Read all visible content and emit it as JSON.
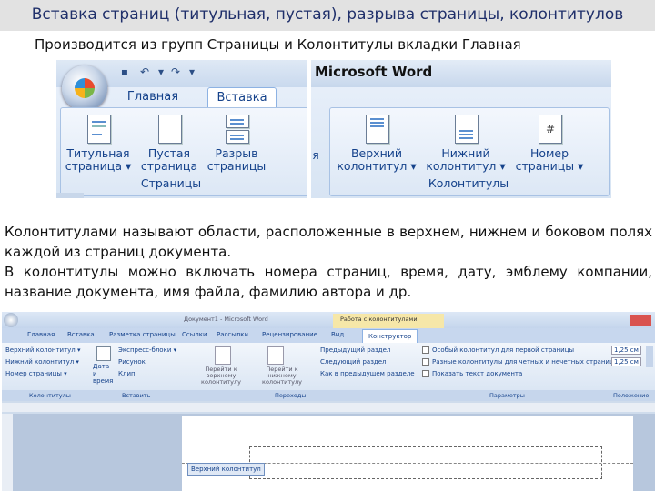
{
  "slide": {
    "title": "Вставка  страниц (титульная, пустая), разрыва страницы, колонтитулов",
    "subtitle": "Производится из групп Страницы и Колонтитулы вкладки Главная",
    "paragraph1": "Колонтитулами называют области, расположенные в верхнем, нижнем и боковом полях каждой из страниц документа.",
    "paragraph2": "В колонтитулы можно включать номера страниц, время, дату, эмблему компании, название документа, имя файла, фамилию автора и др."
  },
  "ribbon_pages": {
    "tabs": [
      "Главная",
      "Вставка"
    ],
    "active_tab": "Вставка",
    "buttons": [
      {
        "line1": "Титульная",
        "line2": "страница ▾"
      },
      {
        "line1": "Пустая",
        "line2": "страница"
      },
      {
        "line1": "Разрыв",
        "line2": "страницы"
      }
    ],
    "group_label": "Страницы"
  },
  "ribbon_headers": {
    "app_title": "Microsoft Word",
    "buttons": [
      {
        "line1": "Верхний",
        "line2": "колонтитул ▾"
      },
      {
        "line1": "Нижний",
        "line2": "колонтитул ▾"
      },
      {
        "line1": "Номер",
        "line2": "страницы ▾"
      }
    ],
    "group_label": "Колонтитулы",
    "partial_label": "я"
  },
  "word_window": {
    "title": "Документ1 - Microsoft Word",
    "context_title": "Работа с колонтитулами",
    "tabs": [
      "Главная",
      "Вставка",
      "Разметка страницы",
      "Ссылки",
      "Рассылки",
      "Рецензирование",
      "Вид",
      "Конструктор"
    ],
    "active_tab": "Конструктор",
    "headers_group": {
      "items": [
        "Верхний колонтитул ▾",
        "Нижний колонтитул ▾",
        "Номер страницы ▾"
      ],
      "label": "Колонтитулы"
    },
    "insert_group": {
      "date_time": "Дата и время",
      "express_blocks": "Экспресс-блоки ▾",
      "picture": "Рисунок",
      "clip": "Клип",
      "label": "Вставить"
    },
    "nav_group": {
      "goto_header": "Перейти к верхнему колонтитулу",
      "goto_footer": "Перейти к нижнему колонтитулу",
      "prev_section": "Предыдущий раздел",
      "next_section": "Следующий раздел",
      "link_previous": "Как в предыдущем разделе",
      "label": "Переходы"
    },
    "params_group": {
      "opt1": "Особый колонтитул для первой страницы",
      "opt2": "Разные колонтитулы для четных и нечетных страниц",
      "opt3": "Показать текст документа",
      "label": "Параметры"
    },
    "position_group": {
      "val1": "1,25 см",
      "val2": "1,25 см",
      "label": "Положение"
    },
    "header_tag": "Верхний колонтитул"
  }
}
